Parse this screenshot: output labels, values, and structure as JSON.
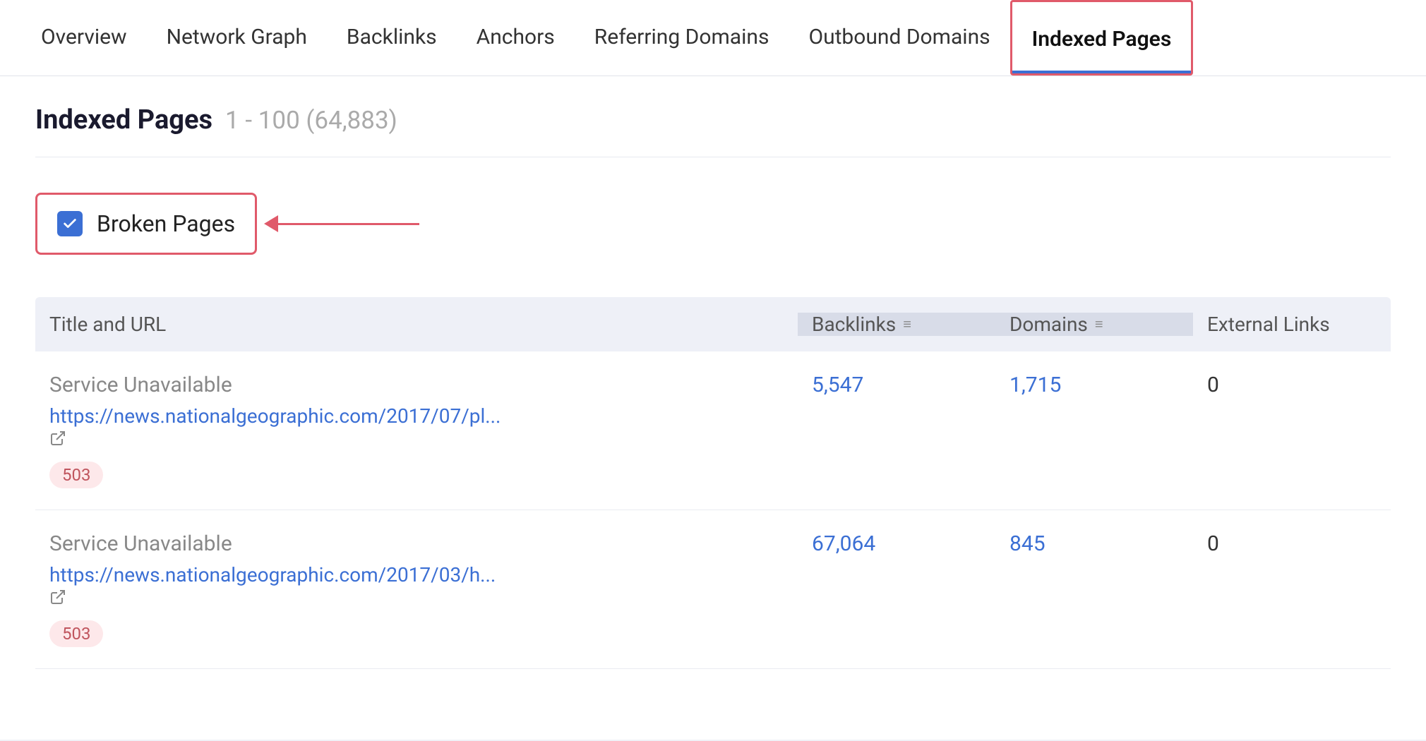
{
  "nav": {
    "items": [
      {
        "label": "Overview",
        "active": false
      },
      {
        "label": "Network Graph",
        "active": false
      },
      {
        "label": "Backlinks",
        "active": false
      },
      {
        "label": "Anchors",
        "active": false
      },
      {
        "label": "Referring Domains",
        "active": false
      },
      {
        "label": "Outbound Domains",
        "active": false
      },
      {
        "label": "Indexed Pages",
        "active": true
      }
    ]
  },
  "page": {
    "title": "Indexed Pages",
    "count": "1 - 100 (64,883)"
  },
  "filter": {
    "broken_pages_label": "Broken Pages",
    "checked": true
  },
  "table": {
    "columns": [
      {
        "label": "Title and URL",
        "sortable": false,
        "highlight": false
      },
      {
        "label": "Backlinks",
        "sortable": true,
        "highlight": true
      },
      {
        "label": "Domains",
        "sortable": true,
        "highlight": true
      },
      {
        "label": "External Links",
        "sortable": false,
        "highlight": false
      }
    ],
    "rows": [
      {
        "title": "Service Unavailable",
        "url": "https://news.nationalgeographic.com/2017/07/pl...",
        "status": "503",
        "backlinks": "5,547",
        "domains": "1,715",
        "external_links": "0"
      },
      {
        "title": "Service Unavailable",
        "url": "https://news.nationalgeographic.com/2017/03/h...",
        "status": "503",
        "backlinks": "67,064",
        "domains": "845",
        "external_links": "0"
      }
    ]
  },
  "icons": {
    "external_link": "↗",
    "sort": "≡",
    "check": "✓"
  }
}
